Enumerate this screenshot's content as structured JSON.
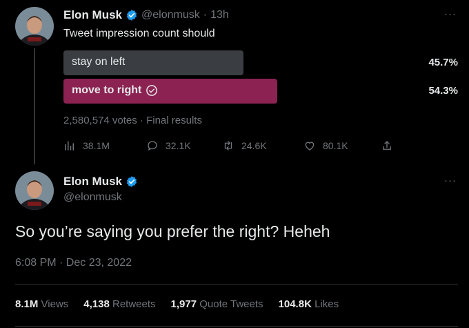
{
  "tweet1": {
    "author_name": "Elon Musk",
    "handle": "@elonmusk",
    "time": "13h",
    "more": "···",
    "text": "Tweet impression count should",
    "poll": {
      "options": [
        {
          "label": "stay on left",
          "percent_text": "45.7%",
          "value": 0.457,
          "winner": false
        },
        {
          "label": "move to right",
          "percent_text": "54.3%",
          "value": 0.543,
          "winner": true
        }
      ],
      "summary": "2,580,574 votes · Final results"
    },
    "actions": {
      "views": "38.1M",
      "replies": "32.1K",
      "retweets": "24.6K",
      "likes": "80.1K"
    }
  },
  "tweet2": {
    "author_name": "Elon Musk",
    "handle": "@elonmusk",
    "more": "···",
    "text": "So you’re saying you prefer the right? Heheh",
    "timestamp": "6:08 PM · Dec 23, 2022",
    "stats": [
      {
        "value": "8.1M",
        "label": "Views"
      },
      {
        "value": "4,138",
        "label": "Retweets"
      },
      {
        "value": "1,977",
        "label": "Quote Tweets"
      },
      {
        "value": "104.8K",
        "label": "Likes"
      }
    ]
  },
  "colors": {
    "background": "#000000",
    "verified_blue": "#1d9bf0",
    "poll_winner": "#8b2252",
    "poll_loser": "#3a3d41",
    "muted_text": "#71767b"
  },
  "icons": [
    "views-icon",
    "reply-icon",
    "retweet-icon",
    "like-icon",
    "share-icon",
    "verified-badge-icon",
    "check-circle-icon"
  ]
}
